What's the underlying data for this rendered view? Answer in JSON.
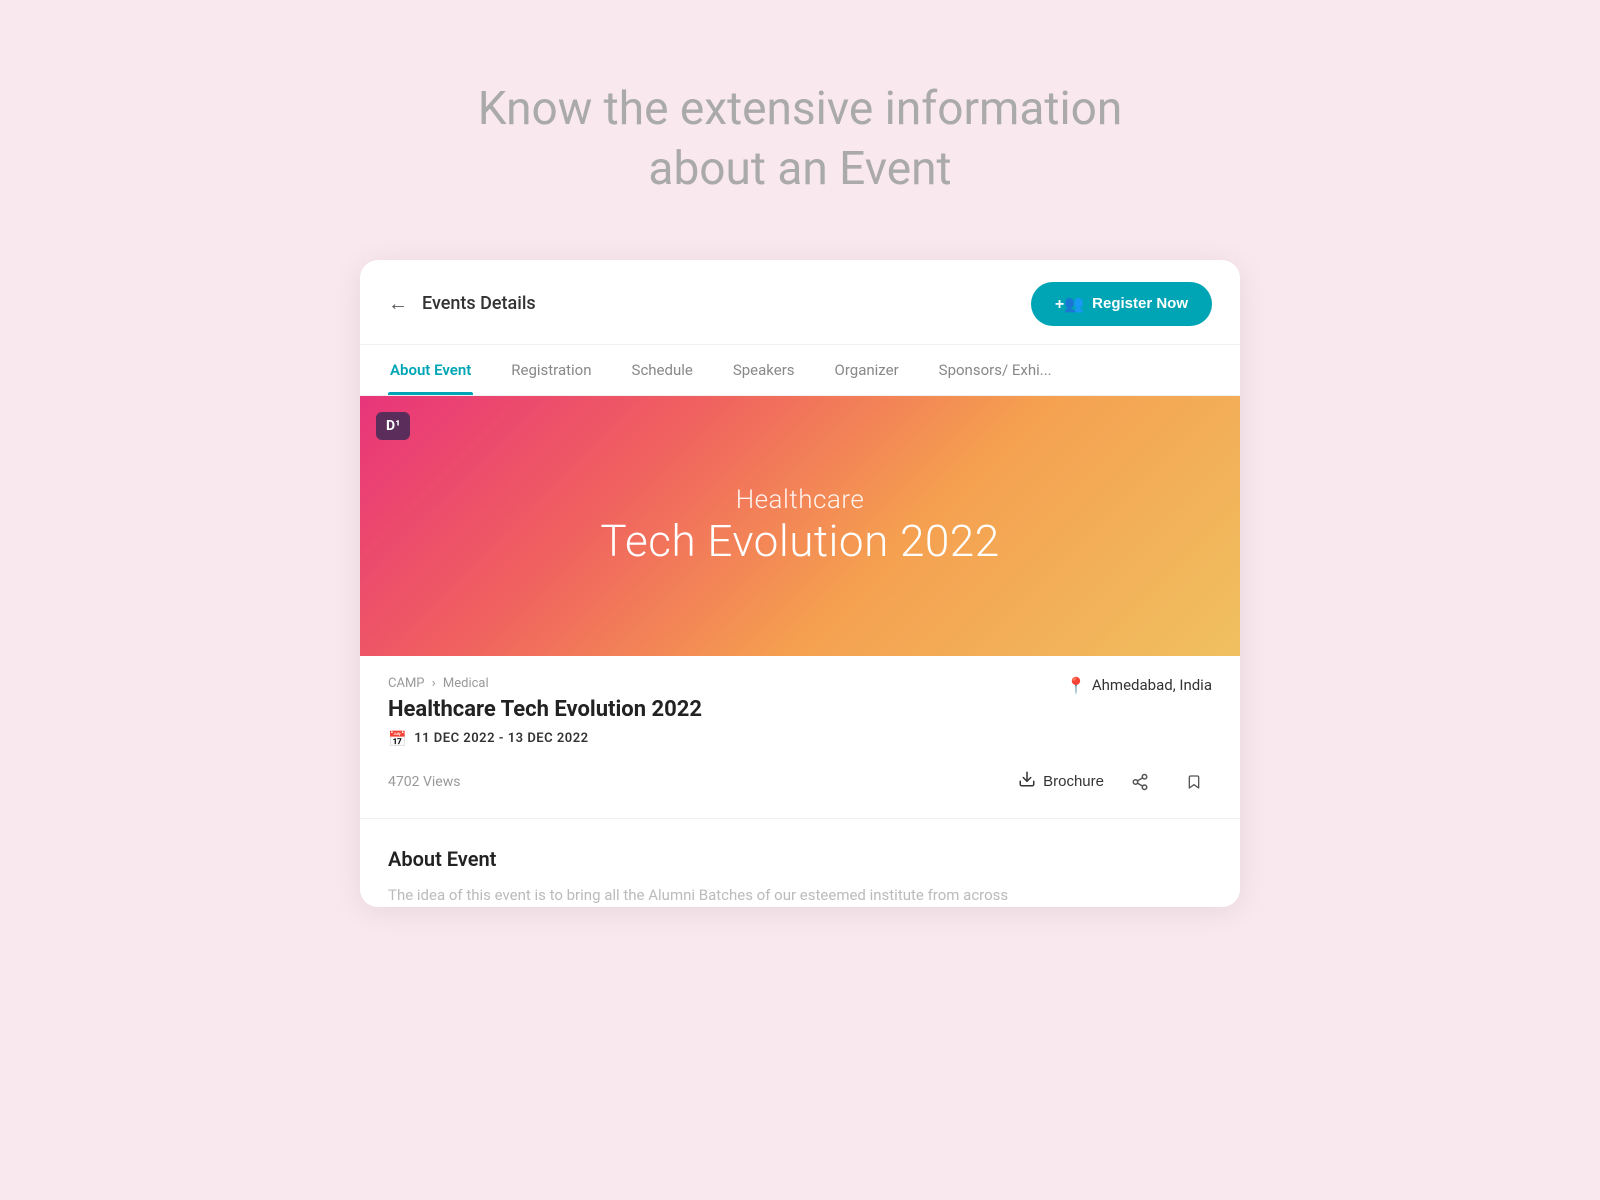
{
  "page": {
    "heading_line1": "Know the extensive information",
    "heading_line2": "about an Event"
  },
  "header": {
    "title": "Events Details",
    "back_label": "←",
    "register_btn_label": "Register Now",
    "register_icon": "👥"
  },
  "tabs": [
    {
      "id": "about",
      "label": "About Event",
      "active": true
    },
    {
      "id": "registration",
      "label": "Registration",
      "active": false
    },
    {
      "id": "schedule",
      "label": "Schedule",
      "active": false
    },
    {
      "id": "speakers",
      "label": "Speakers",
      "active": false
    },
    {
      "id": "organizer",
      "label": "Organizer",
      "active": false
    },
    {
      "id": "sponsors",
      "label": "Sponsors/ Exhi...",
      "active": false
    }
  ],
  "banner": {
    "logo_text": "D¹",
    "subtitle": "Healthcare",
    "title": "Tech Evolution 2022"
  },
  "event": {
    "breadcrumb_category": "CAMP",
    "breadcrumb_separator": "›",
    "breadcrumb_sub": "Medical",
    "name": "Healthcare Tech Evolution 2022",
    "date": "11 DEC 2022 - 13 DEC 2022",
    "location": "Ahmedabad, India",
    "views": "4702 Views",
    "brochure_label": "Brochure"
  },
  "about": {
    "title": "About Event",
    "text": "The idea of this event is to bring all the Alumni Batches of our esteemed institute from across"
  },
  "colors": {
    "accent": "#00a5b5",
    "banner_from": "#e8357a",
    "banner_to": "#f0c060"
  }
}
